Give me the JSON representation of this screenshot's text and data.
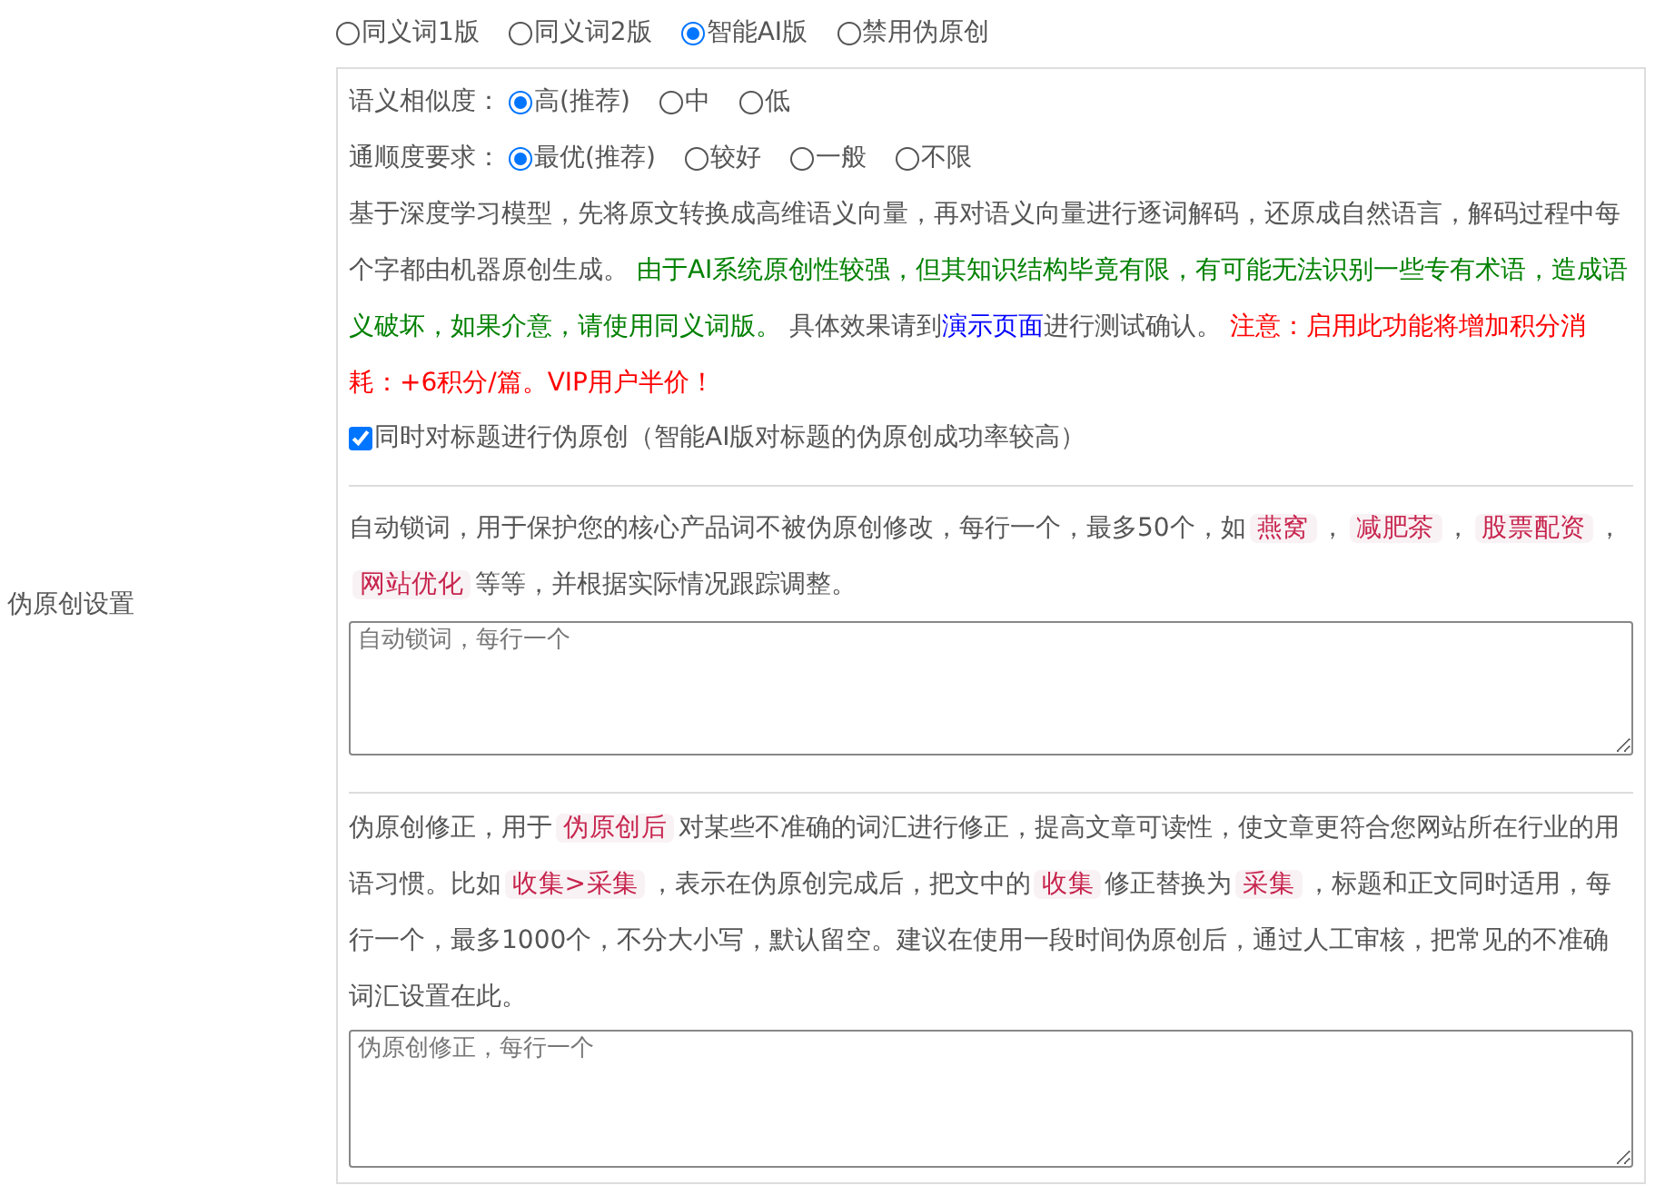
{
  "section_label": "伪原创设置",
  "modes": [
    {
      "label": "同义词1版",
      "selected": false
    },
    {
      "label": "同义词2版",
      "selected": false
    },
    {
      "label": "智能AI版",
      "selected": true
    },
    {
      "label": "禁用伪原创",
      "selected": false
    }
  ],
  "similarity": {
    "label": "语义相似度：",
    "options": [
      {
        "label": "高(推荐)",
        "selected": true
      },
      {
        "label": "中",
        "selected": false
      },
      {
        "label": "低",
        "selected": false
      }
    ]
  },
  "fluency": {
    "label": "通顺度要求：",
    "options": [
      {
        "label": "最优(推荐)",
        "selected": true
      },
      {
        "label": "较好",
        "selected": false
      },
      {
        "label": "一般",
        "selected": false
      },
      {
        "label": "不限",
        "selected": false
      }
    ]
  },
  "ai_description": [
    {
      "kind": "plain",
      "text": "基于深度学习模型，先将原文转换成高维语义向量，再对语义向量进行逐词解码，还原成自然语言，解码过程中每个字都由机器原创生成。 "
    },
    {
      "kind": "green",
      "text": "由于AI系统原创性较强，但其知识结构毕竟有限，有可能无法识别一些专有术语，造成语义破坏，如果介意，请使用同义词版。"
    },
    {
      "kind": "plain",
      "text": " 具体效果请到"
    },
    {
      "kind": "link",
      "text": "演示页面"
    },
    {
      "kind": "plain",
      "text": "进行测试确认。 "
    },
    {
      "kind": "red",
      "text": "注意：启用此功能将增加积分消耗：+6积分/篇。VIP用户半价！"
    }
  ],
  "title_option": {
    "label": "同时对标题进行伪原创（智能AI版对标题的伪原创成功率较高）",
    "checked": true
  },
  "lock_words": {
    "description": [
      {
        "kind": "plain",
        "text": "自动锁词，用于保护您的核心产品词不被伪原创修改，每行一个，最多50个，如"
      },
      {
        "kind": "code",
        "text": "燕窝"
      },
      {
        "kind": "plain",
        "text": "，"
      },
      {
        "kind": "code",
        "text": "减肥茶"
      },
      {
        "kind": "plain",
        "text": "，"
      },
      {
        "kind": "code",
        "text": "股票配资"
      },
      {
        "kind": "plain",
        "text": "，"
      },
      {
        "kind": "code",
        "text": "网站优化"
      },
      {
        "kind": "plain",
        "text": "等等，并根据实际情况跟踪调整。"
      }
    ],
    "placeholder": "自动锁词，每行一个"
  },
  "corrections": {
    "description": [
      {
        "kind": "plain",
        "text": "伪原创修正，用于"
      },
      {
        "kind": "code",
        "text": "伪原创后"
      },
      {
        "kind": "plain",
        "text": "对某些不准确的词汇进行修正，提高文章可读性，使文章更符合您网站所在行业的用语习惯。比如"
      },
      {
        "kind": "code",
        "text": "收集>采集"
      },
      {
        "kind": "plain",
        "text": "，表示在伪原创完成后，把文中的"
      },
      {
        "kind": "code",
        "text": "收集"
      },
      {
        "kind": "plain",
        "text": "修正替换为"
      },
      {
        "kind": "code",
        "text": "采集"
      },
      {
        "kind": "plain",
        "text": "，标题和正文同时适用，每行一个，最多1000个，不分大小写，默认留空。建议在使用一段时间伪原创后，通过人工审核，把常见的不准确词汇设置在此。"
      }
    ],
    "placeholder": "伪原创修正，每行一个"
  }
}
